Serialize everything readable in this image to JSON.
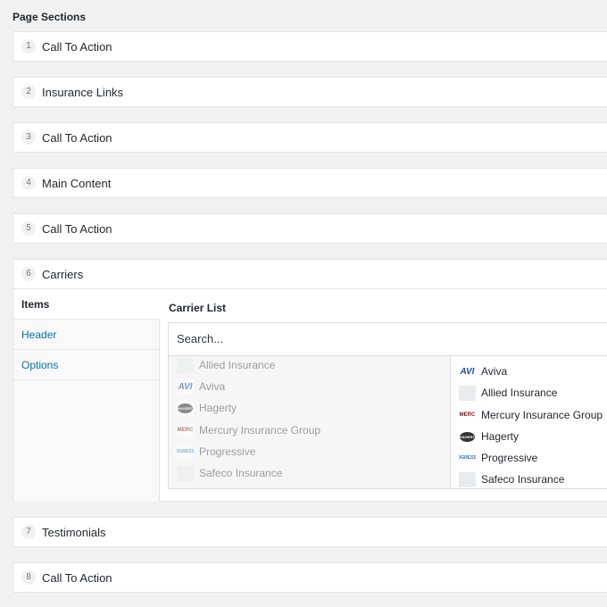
{
  "page": {
    "title": "Page Sections"
  },
  "sections": [
    {
      "num": "1",
      "name": "Call To Action"
    },
    {
      "num": "2",
      "name": "Insurance Links"
    },
    {
      "num": "3",
      "name": "Call To Action"
    },
    {
      "num": "4",
      "name": "Main Content"
    },
    {
      "num": "5",
      "name": "Call To Action"
    },
    {
      "num": "6",
      "name": "Carriers"
    },
    {
      "num": "7",
      "name": "Testimonials"
    },
    {
      "num": "8",
      "name": "Call To Action"
    }
  ],
  "carriers_panel": {
    "tabs": [
      {
        "label": "Items"
      },
      {
        "label": "Header"
      },
      {
        "label": "Options"
      }
    ],
    "carrier_list_label": "Carrier List",
    "search_placeholder": "Search...",
    "available": [
      {
        "name": "Allied Insurance",
        "icon": "allied-logo-icon"
      },
      {
        "name": "Aviva",
        "icon": "aviva-logo-icon",
        "logo_text": "AVI"
      },
      {
        "name": "Hagerty",
        "icon": "hagerty-logo-icon",
        "logo_text": "HAGERTY"
      },
      {
        "name": "Mercury Insurance Group",
        "icon": "mercury-logo-icon",
        "logo_text": "MERC"
      },
      {
        "name": "Progressive",
        "icon": "progressive-logo-icon",
        "logo_text": "PROGRESSIVE"
      },
      {
        "name": "Safeco Insurance",
        "icon": "safeco-logo-icon"
      }
    ],
    "selected": [
      {
        "name": "Aviva",
        "icon": "aviva-logo-icon",
        "logo_text": "AVI"
      },
      {
        "name": "Allied Insurance",
        "icon": "allied-logo-icon"
      },
      {
        "name": "Mercury Insurance Group",
        "icon": "mercury-logo-icon",
        "logo_text": "MERC"
      },
      {
        "name": "Hagerty",
        "icon": "hagerty-logo-icon",
        "logo_text": "HAGERTY"
      },
      {
        "name": "Progressive",
        "icon": "progressive-logo-icon",
        "logo_text": "PROGRESSIVE"
      },
      {
        "name": "Safeco Insurance",
        "icon": "safeco-logo-icon"
      }
    ]
  }
}
